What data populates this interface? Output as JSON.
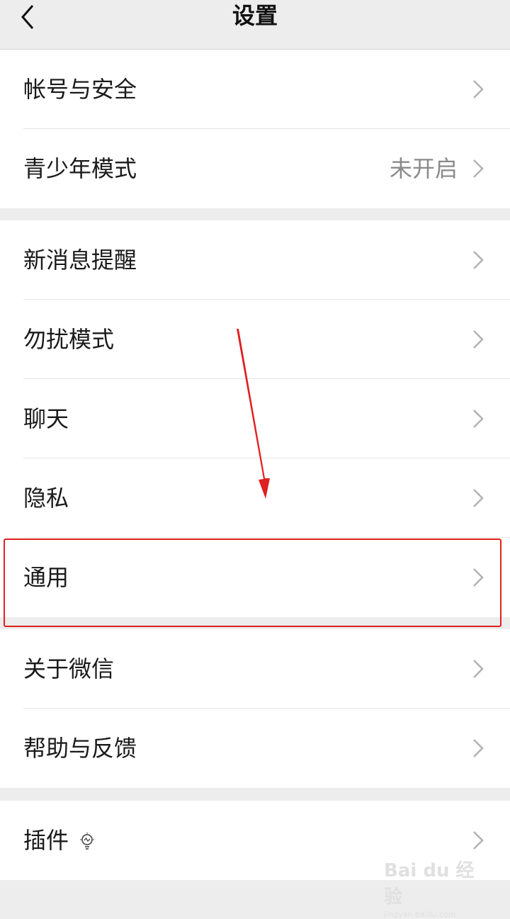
{
  "header": {
    "title": "设置",
    "back_icon": "chevron-left-icon"
  },
  "groups": [
    {
      "items": [
        {
          "label": "帐号与安全",
          "value": ""
        },
        {
          "label": "青少年模式",
          "value": "未开启"
        }
      ]
    },
    {
      "items": [
        {
          "label": "新消息提醒",
          "value": ""
        },
        {
          "label": "勿扰模式",
          "value": ""
        },
        {
          "label": "聊天",
          "value": ""
        },
        {
          "label": "隐私",
          "value": ""
        },
        {
          "label": "通用",
          "value": "",
          "highlighted": true
        }
      ]
    },
    {
      "items": [
        {
          "label": "关于微信",
          "value": ""
        },
        {
          "label": "帮助与反馈",
          "value": ""
        }
      ]
    },
    {
      "items": [
        {
          "label": "插件",
          "value": "",
          "icon": "lightbulb-icon"
        }
      ]
    }
  ],
  "annotation": {
    "highlight_color": "#e02020",
    "arrow_color": "#e02020"
  },
  "watermark": {
    "main": "Bai du 经验",
    "sub": "jingyan.baidu.com"
  }
}
